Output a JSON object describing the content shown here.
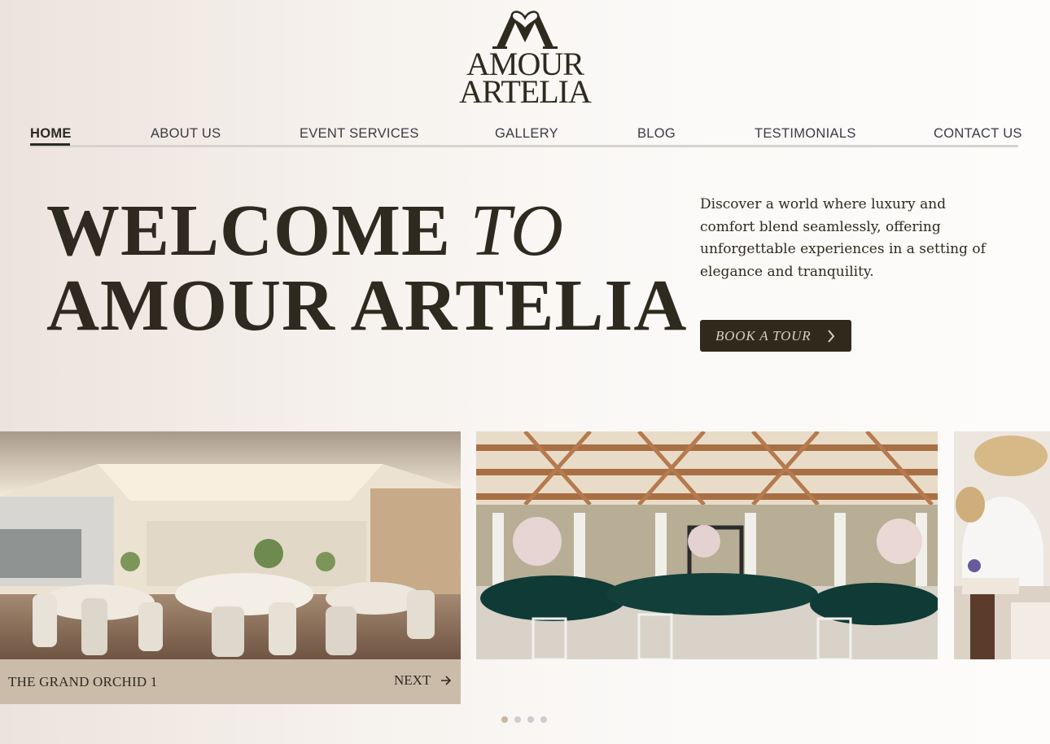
{
  "brand": {
    "line1": "AMOUR",
    "line2": "ARTELIA"
  },
  "nav": {
    "items": [
      {
        "label": "HOME",
        "active": true
      },
      {
        "label": "ABOUT US"
      },
      {
        "label": "EVENT SERVICES"
      },
      {
        "label": "GALLERY"
      },
      {
        "label": "BLOG"
      },
      {
        "label": "TESTIMONIALS"
      },
      {
        "label": "CONTACT US"
      }
    ]
  },
  "hero": {
    "title_word1": "WELCOME",
    "title_word2": "TO",
    "title_line2": "AMOUR ARTELIA",
    "description": "Discover a world where luxury and comfort blend seamlessly, offering unforgettable experiences in a setting of elegance and tranquility.",
    "cta_label": "BOOK A TOUR",
    "cta_icon": "chevron-right-icon"
  },
  "slider": {
    "active_caption": "THE GRAND ORCHID 1",
    "next_label": "NEXT",
    "next_icon": "arrow-right-icon",
    "slides": [
      {
        "image": "ballroom-banquet-photo"
      },
      {
        "image": "garden-pavilion-wedding-photo"
      },
      {
        "image": "chandelier-lounge-photo"
      }
    ],
    "dot_count": 4,
    "active_dot": 1
  },
  "colors": {
    "primary_dark": "#302a1c",
    "caption_bg": "#cbbcaa",
    "dot_active": "#c7b6a3",
    "dot_inactive": "#cfcbd2"
  }
}
